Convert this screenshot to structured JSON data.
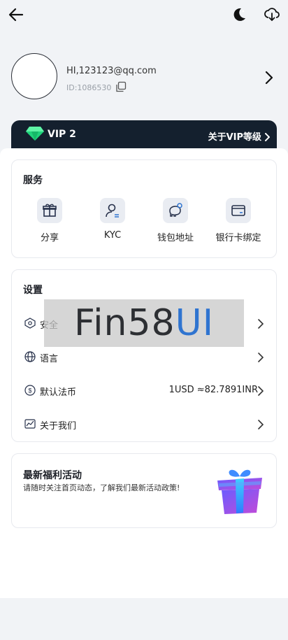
{
  "profile": {
    "email": "HI,123123@qq.com",
    "id_text": "ID:1086530"
  },
  "vip": {
    "level": "VIP 2",
    "about": "关于VIP等级"
  },
  "services": {
    "title": "服务",
    "items": [
      {
        "label": "分享",
        "icon": "gift-icon"
      },
      {
        "label": "KYC",
        "icon": "user-verify-icon"
      },
      {
        "label": "钱包地址",
        "icon": "piggy-bank-icon"
      },
      {
        "label": "银行卡绑定",
        "icon": "bank-card-icon"
      }
    ]
  },
  "settings": {
    "title": "设置",
    "items": [
      {
        "label": "安全",
        "icon": "shield-icon"
      },
      {
        "label": "语言",
        "icon": "globe-icon"
      },
      {
        "label": "默认法币",
        "icon": "dollar-icon",
        "value": "1USD ≈82.7891INR"
      },
      {
        "label": "关于我们",
        "icon": "chart-icon"
      }
    ]
  },
  "watermark": {
    "part1": "Fin58",
    "part2": "UI"
  },
  "promo": {
    "title": "最新福利活动",
    "desc": "请随时关注首页动态，了解我们最新活动政策!"
  },
  "colors": {
    "vip_bg": "#14202e",
    "accent_blue": "#2f74d0",
    "icon_box": "#e9ecf2"
  }
}
